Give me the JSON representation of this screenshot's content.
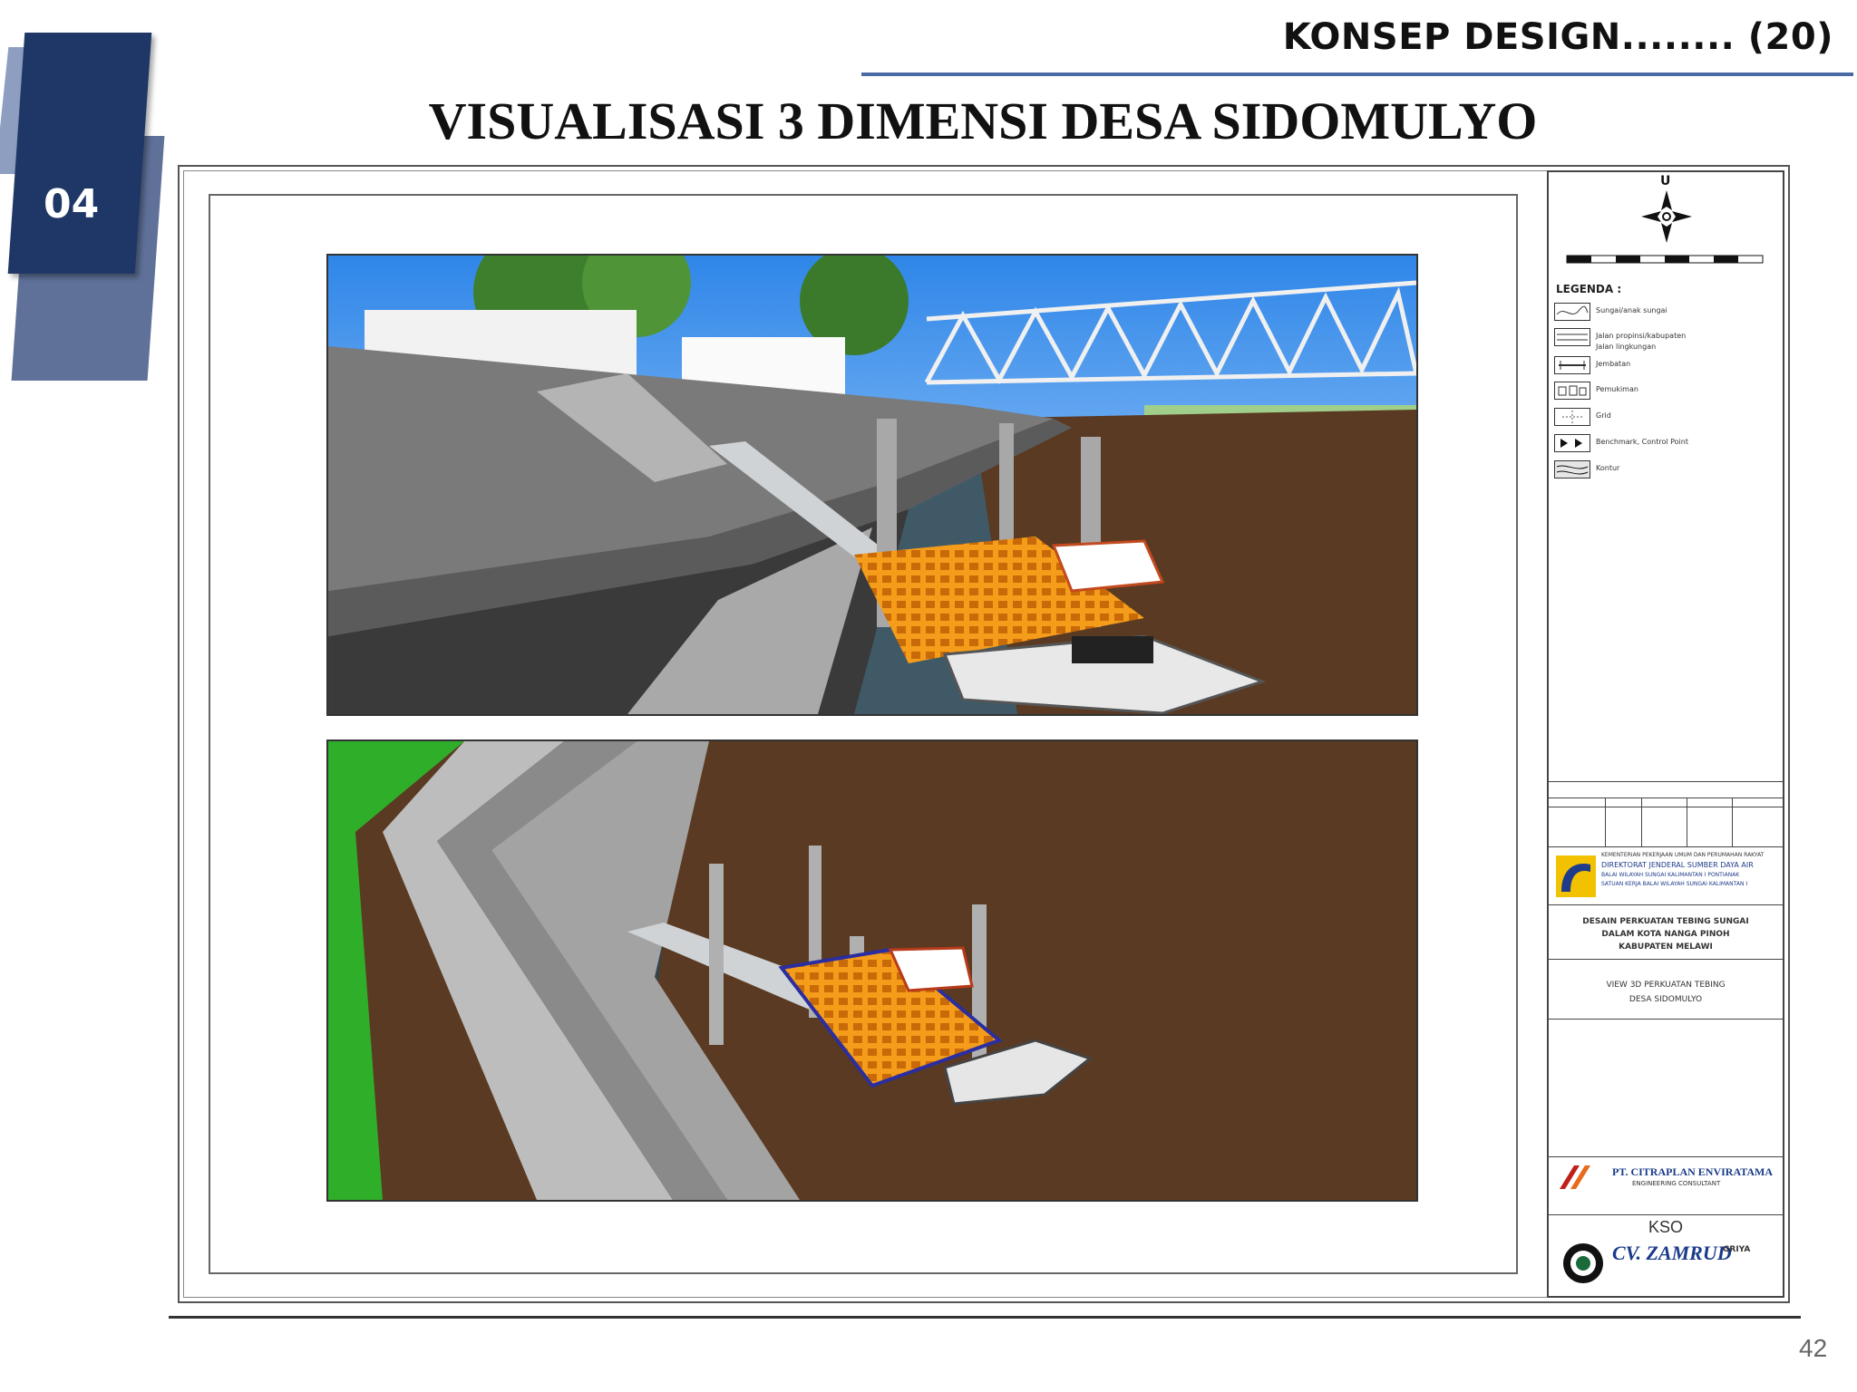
{
  "header": {
    "section_label": "KONSEP DESIGN........ (20)"
  },
  "title": "VISUALISASI 3 DIMENSI DESA SIDOMULYO",
  "section_badge": {
    "number": "04"
  },
  "sheet": {
    "north_label": "U",
    "legend": {
      "title": "LEGENDA :",
      "items": [
        {
          "label": "Sungai/anak sungai",
          "icon": "river-icon"
        },
        {
          "label": "Jalan propinsi/kabupaten",
          "icon": "road-icon"
        },
        {
          "label": "Jalan lingkungan",
          "icon": "road-icon"
        },
        {
          "label": "Jembatan",
          "icon": "bridge-icon"
        },
        {
          "label": "Pemukiman",
          "icon": "settlement-icon"
        },
        {
          "label": "Grid",
          "icon": "grid-icon"
        },
        {
          "label": "Benchmark, Control Point",
          "icon": "benchmark-icon"
        },
        {
          "label": "Kontur",
          "icon": "contour-icon"
        }
      ]
    },
    "owner": {
      "line1": "KEMENTERIAN PEKERJAAN UMUM DAN PERUMAHAN RAKYAT",
      "line2": "DIREKTORAT JENDERAL SUMBER DAYA AIR",
      "line3": "BALAI WILAYAH SUNGAI KALIMANTAN I PONTIANAK",
      "line4": "SATUAN KERJA BALAI WILAYAH SUNGAI KALIMANTAN I"
    },
    "project": {
      "line1": "DESAIN PERKUATAN TEBING SUNGAI",
      "line2": "DALAM KOTA NANGA PINOH",
      "line3": "KABUPATEN MELAWI"
    },
    "drawing_title": {
      "line1": "VIEW 3D PERKUATAN TEBING",
      "line2": "DESA SIDOMULYO"
    },
    "consultant1": {
      "name": "PT. CITRAPLAN ENVIRATAMA",
      "sub": "ENGINEERING CONSULTANT"
    },
    "kso": "KSO",
    "consultant2": {
      "name": "CV. ZAMRUD",
      "sub": "GRIYA"
    }
  },
  "colors": {
    "accent": "#1f3766",
    "rule": "#4a6aa6",
    "water": "#5a3a22",
    "dock": "#f39a1e"
  },
  "page_number": "42"
}
